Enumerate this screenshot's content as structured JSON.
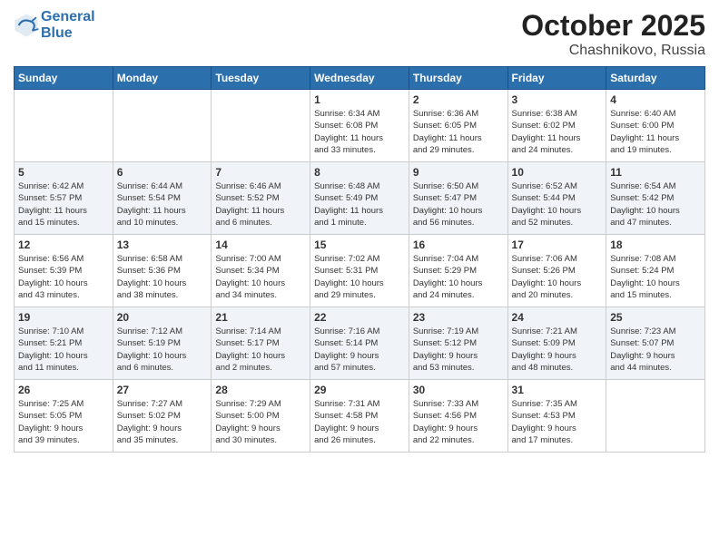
{
  "header": {
    "logo_line1": "General",
    "logo_line2": "Blue",
    "month": "October 2025",
    "location": "Chashnikovo, Russia"
  },
  "days_of_week": [
    "Sunday",
    "Monday",
    "Tuesday",
    "Wednesday",
    "Thursday",
    "Friday",
    "Saturday"
  ],
  "weeks": [
    [
      {
        "num": "",
        "info": ""
      },
      {
        "num": "",
        "info": ""
      },
      {
        "num": "",
        "info": ""
      },
      {
        "num": "1",
        "info": "Sunrise: 6:34 AM\nSunset: 6:08 PM\nDaylight: 11 hours\nand 33 minutes."
      },
      {
        "num": "2",
        "info": "Sunrise: 6:36 AM\nSunset: 6:05 PM\nDaylight: 11 hours\nand 29 minutes."
      },
      {
        "num": "3",
        "info": "Sunrise: 6:38 AM\nSunset: 6:02 PM\nDaylight: 11 hours\nand 24 minutes."
      },
      {
        "num": "4",
        "info": "Sunrise: 6:40 AM\nSunset: 6:00 PM\nDaylight: 11 hours\nand 19 minutes."
      }
    ],
    [
      {
        "num": "5",
        "info": "Sunrise: 6:42 AM\nSunset: 5:57 PM\nDaylight: 11 hours\nand 15 minutes."
      },
      {
        "num": "6",
        "info": "Sunrise: 6:44 AM\nSunset: 5:54 PM\nDaylight: 11 hours\nand 10 minutes."
      },
      {
        "num": "7",
        "info": "Sunrise: 6:46 AM\nSunset: 5:52 PM\nDaylight: 11 hours\nand 6 minutes."
      },
      {
        "num": "8",
        "info": "Sunrise: 6:48 AM\nSunset: 5:49 PM\nDaylight: 11 hours\nand 1 minute."
      },
      {
        "num": "9",
        "info": "Sunrise: 6:50 AM\nSunset: 5:47 PM\nDaylight: 10 hours\nand 56 minutes."
      },
      {
        "num": "10",
        "info": "Sunrise: 6:52 AM\nSunset: 5:44 PM\nDaylight: 10 hours\nand 52 minutes."
      },
      {
        "num": "11",
        "info": "Sunrise: 6:54 AM\nSunset: 5:42 PM\nDaylight: 10 hours\nand 47 minutes."
      }
    ],
    [
      {
        "num": "12",
        "info": "Sunrise: 6:56 AM\nSunset: 5:39 PM\nDaylight: 10 hours\nand 43 minutes."
      },
      {
        "num": "13",
        "info": "Sunrise: 6:58 AM\nSunset: 5:36 PM\nDaylight: 10 hours\nand 38 minutes."
      },
      {
        "num": "14",
        "info": "Sunrise: 7:00 AM\nSunset: 5:34 PM\nDaylight: 10 hours\nand 34 minutes."
      },
      {
        "num": "15",
        "info": "Sunrise: 7:02 AM\nSunset: 5:31 PM\nDaylight: 10 hours\nand 29 minutes."
      },
      {
        "num": "16",
        "info": "Sunrise: 7:04 AM\nSunset: 5:29 PM\nDaylight: 10 hours\nand 24 minutes."
      },
      {
        "num": "17",
        "info": "Sunrise: 7:06 AM\nSunset: 5:26 PM\nDaylight: 10 hours\nand 20 minutes."
      },
      {
        "num": "18",
        "info": "Sunrise: 7:08 AM\nSunset: 5:24 PM\nDaylight: 10 hours\nand 15 minutes."
      }
    ],
    [
      {
        "num": "19",
        "info": "Sunrise: 7:10 AM\nSunset: 5:21 PM\nDaylight: 10 hours\nand 11 minutes."
      },
      {
        "num": "20",
        "info": "Sunrise: 7:12 AM\nSunset: 5:19 PM\nDaylight: 10 hours\nand 6 minutes."
      },
      {
        "num": "21",
        "info": "Sunrise: 7:14 AM\nSunset: 5:17 PM\nDaylight: 10 hours\nand 2 minutes."
      },
      {
        "num": "22",
        "info": "Sunrise: 7:16 AM\nSunset: 5:14 PM\nDaylight: 9 hours\nand 57 minutes."
      },
      {
        "num": "23",
        "info": "Sunrise: 7:19 AM\nSunset: 5:12 PM\nDaylight: 9 hours\nand 53 minutes."
      },
      {
        "num": "24",
        "info": "Sunrise: 7:21 AM\nSunset: 5:09 PM\nDaylight: 9 hours\nand 48 minutes."
      },
      {
        "num": "25",
        "info": "Sunrise: 7:23 AM\nSunset: 5:07 PM\nDaylight: 9 hours\nand 44 minutes."
      }
    ],
    [
      {
        "num": "26",
        "info": "Sunrise: 7:25 AM\nSunset: 5:05 PM\nDaylight: 9 hours\nand 39 minutes."
      },
      {
        "num": "27",
        "info": "Sunrise: 7:27 AM\nSunset: 5:02 PM\nDaylight: 9 hours\nand 35 minutes."
      },
      {
        "num": "28",
        "info": "Sunrise: 7:29 AM\nSunset: 5:00 PM\nDaylight: 9 hours\nand 30 minutes."
      },
      {
        "num": "29",
        "info": "Sunrise: 7:31 AM\nSunset: 4:58 PM\nDaylight: 9 hours\nand 26 minutes."
      },
      {
        "num": "30",
        "info": "Sunrise: 7:33 AM\nSunset: 4:56 PM\nDaylight: 9 hours\nand 22 minutes."
      },
      {
        "num": "31",
        "info": "Sunrise: 7:35 AM\nSunset: 4:53 PM\nDaylight: 9 hours\nand 17 minutes."
      },
      {
        "num": "",
        "info": ""
      }
    ]
  ]
}
